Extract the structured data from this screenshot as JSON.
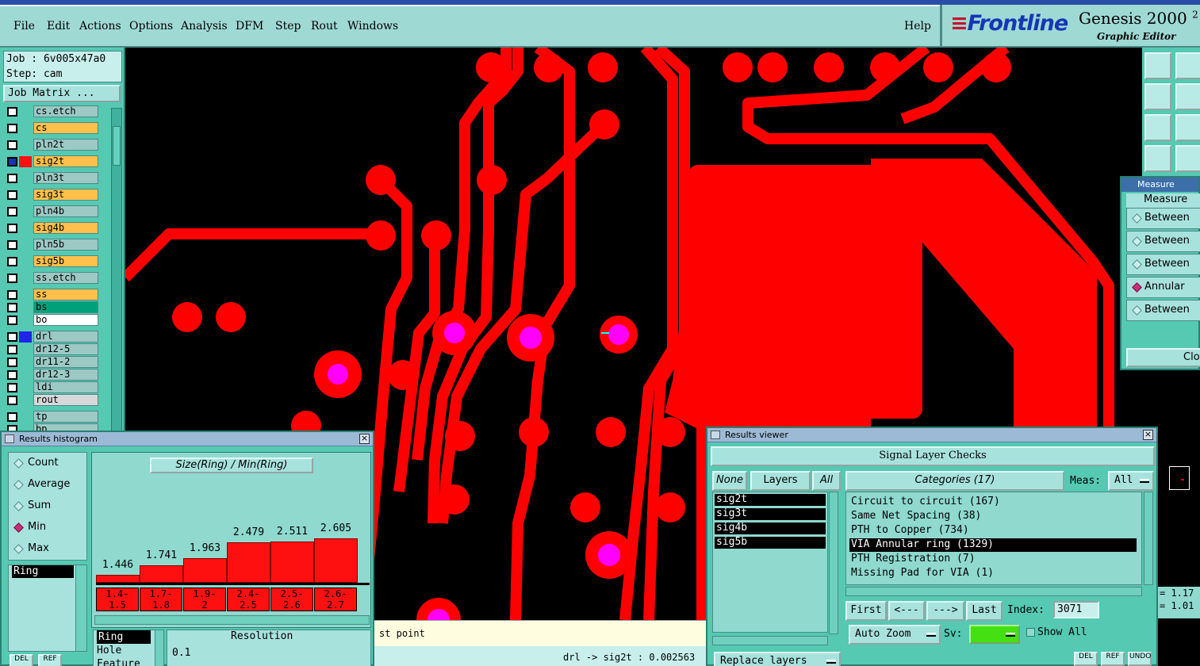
{
  "menubar": {
    "items": [
      "File",
      "Edit",
      "Actions",
      "Options",
      "Analysis",
      "DFM",
      "Step",
      "Rout",
      "Windows"
    ],
    "help": "Help"
  },
  "brand": {
    "logo": "Frontline",
    "title": "Genesis 2000",
    "version_fragment": "2",
    "subtitle": "Graphic Editor"
  },
  "job": {
    "job_line": "Job : 6v005x47a0",
    "step_line": "Step: cam",
    "matrix_button": "Job Matrix ..."
  },
  "layers": [
    {
      "name": "cs.etch",
      "color": "#9cc9c4"
    },
    {
      "name": "cs",
      "color": "#ffc04c"
    },
    {
      "name": "pln2t",
      "color": "#9cc9c4"
    },
    {
      "name": "sig2t",
      "color": "#ffc04c"
    },
    {
      "name": "pln3t",
      "color": "#9cc9c4"
    },
    {
      "name": "sig3t",
      "color": "#ffc04c"
    },
    {
      "name": "pln4b",
      "color": "#9cc9c4"
    },
    {
      "name": "sig4b",
      "color": "#ffc04c"
    },
    {
      "name": "pln5b",
      "color": "#9cc9c4"
    },
    {
      "name": "sig5b",
      "color": "#ffc04c"
    },
    {
      "name": "ss.etch",
      "color": "#9cc9c4"
    },
    {
      "name": "ss",
      "color": "#ffc04c"
    },
    {
      "name": "bs",
      "color": "#00a07a"
    },
    {
      "name": "bo",
      "color": "#ffffff"
    },
    {
      "name": "drl",
      "color": "#9cc9c4"
    },
    {
      "name": "dr12-5",
      "color": "#9cc9c4"
    },
    {
      "name": "dr11-2",
      "color": "#9cc9c4"
    },
    {
      "name": "dr12-3",
      "color": "#9cc9c4"
    },
    {
      "name": "ldi",
      "color": "#9cc9c4"
    },
    {
      "name": "rout",
      "color": "#d8d8d8"
    },
    {
      "name": "tp",
      "color": "#9cc9c4"
    },
    {
      "name": "bp",
      "color": "#9cc9c4"
    }
  ],
  "measure_popup": {
    "title": "Measure Popu",
    "header": "Measure",
    "options": [
      {
        "label": "Between",
        "selected": false
      },
      {
        "label": "Between",
        "selected": false
      },
      {
        "label": "Between",
        "selected": false
      },
      {
        "label": "Annular",
        "selected": true
      },
      {
        "label": "Between",
        "selected": false
      }
    ],
    "close": "Clo"
  },
  "status": {
    "prompt": "st point",
    "readout": "drl -> sig2t : 0.002563"
  },
  "histogram": {
    "title": "Results histogram",
    "modes": [
      {
        "label": "Count",
        "selected": false
      },
      {
        "label": "Average",
        "selected": false
      },
      {
        "label": "Sum",
        "selected": false
      },
      {
        "label": "Min",
        "selected": true
      },
      {
        "label": "Max",
        "selected": false
      }
    ],
    "plot_label": "Size(Ring) / Min(Ring)",
    "ring_selected": "Ring",
    "types": [
      "Ring",
      "Hole",
      "Feature"
    ],
    "resolution_label": "Resolution",
    "resolution_value": "0.1",
    "buttons": [
      "DEL",
      "REF"
    ]
  },
  "chart_data": {
    "type": "bar",
    "title": "Size(Ring) / Min(Ring)",
    "categories": [
      "1.4-1.5",
      "1.7-1.8",
      "1.9-2",
      "2.4-2.5",
      "2.5-2.6",
      "2.6-2.7"
    ],
    "category_labels": [
      [
        "1.4-",
        "1.5"
      ],
      [
        "1.7-",
        "1.8"
      ],
      [
        "1.9-",
        "2"
      ],
      [
        "2.4-",
        "2.5"
      ],
      [
        "2.5-",
        "2.6"
      ],
      [
        "2.6-",
        "2.7"
      ]
    ],
    "values": [
      1.446,
      1.741,
      1.963,
      2.479,
      2.511,
      2.605
    ],
    "value_labels": [
      "1.446",
      "1.741",
      "1.963",
      "2.479",
      "2.511",
      "2.605"
    ],
    "ylim": [
      0,
      2.7
    ],
    "bar_color": "#ff1010"
  },
  "results_viewer": {
    "title": "Results viewer",
    "header": "Signal Layer Checks",
    "none_btn": "None",
    "layers_btn": "Layers",
    "all_btn": "All",
    "categories_btn": "Categories (17)",
    "meas_label": "Meas:",
    "meas_value": "All",
    "layers": [
      "sig2t",
      "sig3t",
      "sig4b",
      "sig5b"
    ],
    "categories": [
      {
        "label": "Circuit to circuit (167)",
        "selected": false
      },
      {
        "label": "Same Net Spacing (38)",
        "selected": false
      },
      {
        "label": "PTH to Copper (734)",
        "selected": false
      },
      {
        "label": "VIA Annular ring (1329)",
        "selected": true
      },
      {
        "label": "PTH Registration (7)",
        "selected": false
      },
      {
        "label": "Missing Pad for VIA (1)",
        "selected": false
      }
    ],
    "first": "First",
    "prev": "<---",
    "next": "--->",
    "last": "Last",
    "index_label": "Index:",
    "index_value": "3071",
    "auto_zoom": "Auto Zoom",
    "sv_label": "Sv:",
    "show_all": "Show All",
    "replace_layers": "Replace layers",
    "bottom_buttons": [
      "DEL",
      "REF",
      "UNDO"
    ]
  },
  "side_readout": [
    "= 1.17",
    "= 1.01"
  ],
  "colors": {
    "copper": "#ff0000",
    "via": "#ff00ff",
    "panel": "#55c9b2",
    "menubar": "#9fd9d4"
  }
}
